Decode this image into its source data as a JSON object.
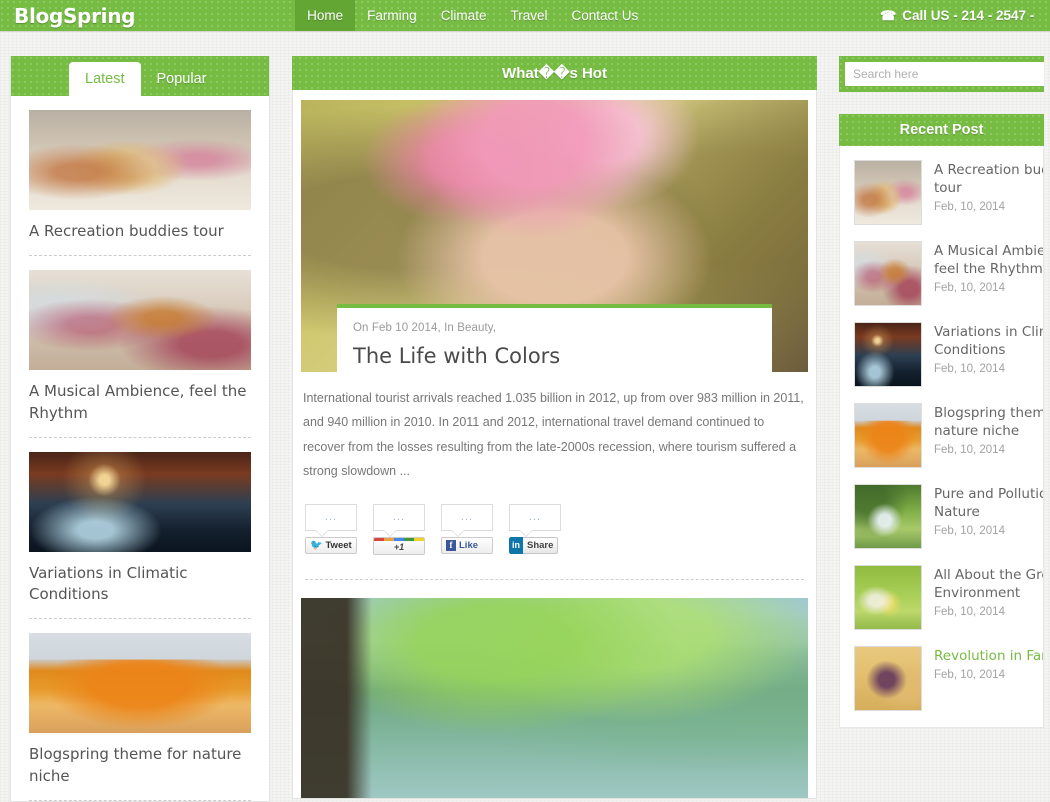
{
  "header": {
    "logo": "BlogSpring",
    "nav": [
      {
        "label": "Home",
        "active": true
      },
      {
        "label": "Farming",
        "active": false
      },
      {
        "label": "Climate",
        "active": false
      },
      {
        "label": "Travel",
        "active": false
      },
      {
        "label": "Contact Us",
        "active": false
      }
    ],
    "phone_icon": "phone-icon",
    "phone": "Call US - 214 - 2547 -",
    "accent_color": "#76bc43",
    "active_nav_color": "#63a634"
  },
  "left_sidebar": {
    "tabs": [
      {
        "label": "Latest",
        "active": true
      },
      {
        "label": "Popular",
        "active": false
      }
    ],
    "posts": [
      {
        "title": "A Recreation buddies tour",
        "image": "beach-water-fight"
      },
      {
        "title": "A Musical Ambience, feel the Rhythm",
        "image": "guitar-cafe"
      },
      {
        "title": "Variations in Climatic Conditions",
        "image": "night-boat-lake"
      },
      {
        "title": "Blogspring theme for nature niche",
        "image": "autumn-city-park"
      }
    ]
  },
  "main": {
    "section_title": "What��s Hot",
    "articles": [
      {
        "image": "girl-flower-crown",
        "meta": "On Feb 10 2014, In Beauty,",
        "title": "The Life with Colors",
        "excerpt": "International tourist arrivals reached 1.035 billion in 2012, up from over 983 million in 2011, and 940 million in 2010. In 2011 and 2012, international travel demand continued to recover from the losses resulting from the late-2000s recession, where tourism suffered a strong slowdown ...",
        "share": [
          {
            "name": "twitter",
            "bubble": "...",
            "label": "Tweet"
          },
          {
            "name": "google-plus",
            "bubble": "...",
            "label": "+1"
          },
          {
            "name": "facebook",
            "bubble": "...",
            "label": "Like"
          },
          {
            "name": "linkedin",
            "bubble": "...",
            "label": "Share",
            "badge": "in"
          }
        ]
      },
      {
        "image": "misty-forest-lake"
      }
    ]
  },
  "right_sidebar": {
    "search_placeholder": "Search here",
    "search_value": "",
    "recent_title": "Recent Post",
    "recent_posts": [
      {
        "title": "A Recreation budd",
        "title2": "tour",
        "date": "Feb, 10, 2014",
        "image": "beach-water-fight",
        "highlight": false
      },
      {
        "title": "A Musical Ambienc",
        "title2": "feel the Rhythm",
        "date": "Feb, 10, 2014",
        "image": "guitar-cafe",
        "highlight": false
      },
      {
        "title": "Variations in Clima",
        "title2": "Conditions",
        "date": "Feb, 10, 2014",
        "image": "night-boat-lake",
        "highlight": false
      },
      {
        "title": "Blogspring theme",
        "title2": "nature niche",
        "date": "Feb, 10, 2014",
        "image": "autumn-city-park",
        "highlight": false
      },
      {
        "title": "Pure and Pollution",
        "title2": "Nature",
        "date": "Feb, 10, 2014",
        "image": "girl-green-pond",
        "highlight": false
      },
      {
        "title": "All About the Gree",
        "title2": "Environment",
        "date": "Feb, 10, 2014",
        "image": "woman-flowers-field",
        "highlight": false
      },
      {
        "title": "Revolution in Farm",
        "title2": "",
        "date": "Feb, 10, 2014",
        "image": "grapes-fruit",
        "highlight": true
      }
    ]
  }
}
